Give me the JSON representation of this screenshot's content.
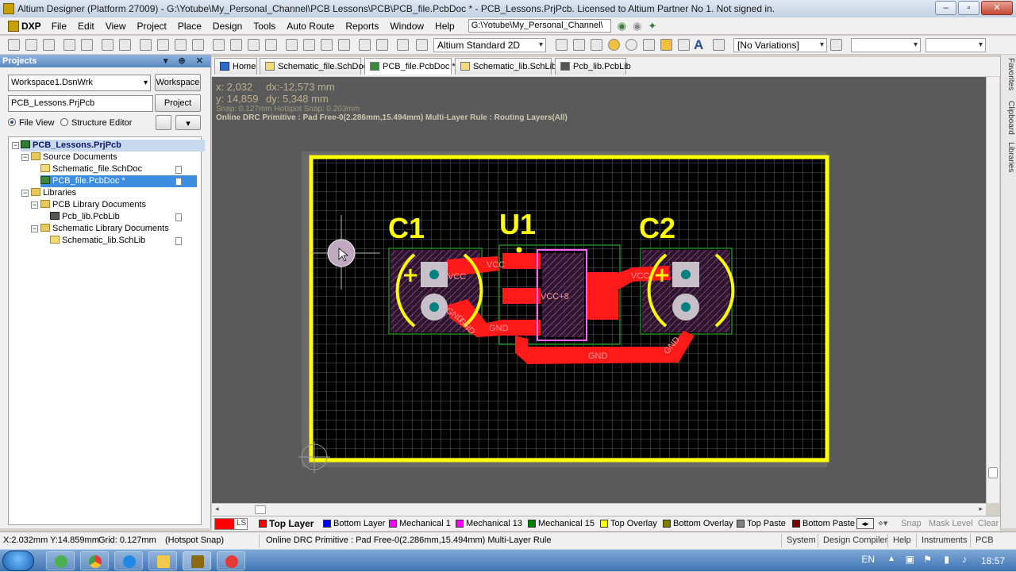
{
  "window": {
    "title": "Altium Designer (Platform 27009) - G:\\Yotube\\My_Personal_Channel\\PCB Lessons\\PCB\\PCB_file.PcbDoc * - PCB_Lessons.PrjPcb. Licensed to Altium Partner No 1. Not signed in."
  },
  "menu": {
    "dxp": "DXP",
    "items": [
      "File",
      "Edit",
      "View",
      "Project",
      "Place",
      "Design",
      "Tools",
      "Auto Route",
      "Reports",
      "Window",
      "Help"
    ],
    "path": "G:\\Yotube\\My_Personal_Channel\\"
  },
  "toolbar": {
    "view_mode": "Altium Standard 2D",
    "variations": "[No Variations]"
  },
  "projects": {
    "title": "Projects",
    "workspace_value": "Workspace1.DsnWrk",
    "workspace_button": "Workspace",
    "project_value": "PCB_Lessons.PrjPcb",
    "project_button": "Project",
    "file_view": "File View",
    "structure_editor": "Structure Editor",
    "tree": {
      "root": "PCB_Lessons.PrjPcb",
      "source_documents": "Source Documents",
      "schematic_file": "Schematic_file.SchDoc",
      "pcb_file": "PCB_file.PcbDoc *",
      "libraries": "Libraries",
      "pcb_library_documents": "PCB Library Documents",
      "pcb_lib": "Pcb_lib.PcbLib",
      "schematic_library_documents": "Schematic Library Documents",
      "sch_lib": "Schematic_lib.SchLib"
    }
  },
  "doc_tabs": [
    "Home",
    "Schematic_file.SchDoc",
    "PCB_file.PcbDoc *",
    "Schematic_lib.SchLib",
    "Pcb_lib.PcbLib"
  ],
  "hud": {
    "x": "x: 2,032",
    "dx": "dx:-12,573 mm",
    "y": "y: 14,859",
    "dy": "dy: 5,348 mm",
    "snap": "Snap: 0.127mm Hotspot Snap: 0.203mm",
    "drc": "Online DRC Primitive : Pad Free-0(2.286mm,15.494mm)  Multi-Layer Rule : Routing Layers(All)"
  },
  "pcb": {
    "designators": {
      "c1": "C1",
      "u1": "U1",
      "c2": "C2"
    },
    "nets": {
      "vcc1": "VCC",
      "vcc2": "VCC",
      "vcc3": "VCC",
      "vcc_u1": "VCC+8",
      "gnd1": "GND",
      "gnd2": "GND",
      "gnd3": "GND",
      "gnd4": "GND",
      "gnd5": "GND"
    },
    "colors": {
      "board_outline": "#ffff00",
      "top_layer": "#ff0000",
      "top_overlay": "#ffff00",
      "pad": "#c0c0c0",
      "via_hole": "#008080",
      "grid": "#808080"
    }
  },
  "layers": {
    "ls": "LS",
    "items": [
      {
        "name": "Top Layer",
        "color": "#ff0000"
      },
      {
        "name": "Bottom Layer",
        "color": "#0000ff"
      },
      {
        "name": "Mechanical 1",
        "color": "#ff00ff"
      },
      {
        "name": "Mechanical 13",
        "color": "#ff00ff"
      },
      {
        "name": "Mechanical 15",
        "color": "#008000"
      },
      {
        "name": "Top Overlay",
        "color": "#ffff00"
      },
      {
        "name": "Bottom Overlay",
        "color": "#808000"
      },
      {
        "name": "Top Paste",
        "color": "#808080"
      },
      {
        "name": "Bottom Paste",
        "color": "#800000"
      }
    ],
    "snap": "Snap",
    "mask_level": "Mask Level",
    "clear": "Clear"
  },
  "status": {
    "coords": "X:2.032mm Y:14.859mm",
    "grid": "Grid: 0.127mm",
    "hotspot": "(Hotspot Snap)",
    "drc": "Online DRC Primitive : Pad Free-0(2.286mm,15.494mm)  Multi-Layer Rule",
    "buttons": [
      "System",
      "Design Compiler",
      "Help",
      "Instruments",
      "PCB"
    ]
  },
  "right_panels": [
    "Favorites",
    "Clipboard",
    "Libraries"
  ],
  "taskbar": {
    "lang": "EN",
    "time": "18:57"
  }
}
